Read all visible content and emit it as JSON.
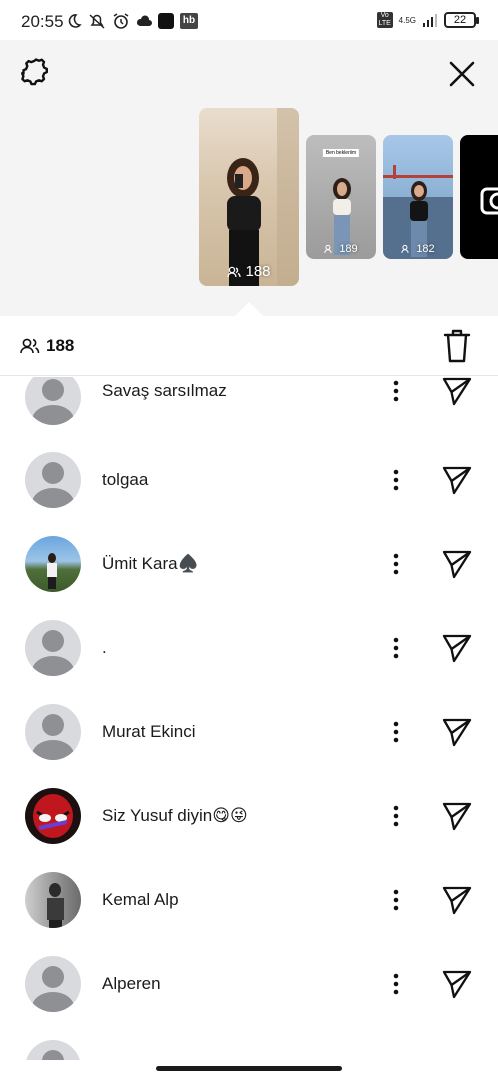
{
  "status_bar": {
    "time": "20:55",
    "network": "4.5G",
    "volte": "Vo LTE",
    "battery": "22",
    "app_badge": "hb"
  },
  "story_panel": {
    "settings_icon": "gear-icon",
    "close_icon": "close-icon",
    "thumbnails": [
      {
        "count": "188",
        "selected": true
      },
      {
        "count": "189",
        "tag": "Ben bekleriim"
      },
      {
        "count": "182"
      },
      {
        "type": "camera"
      }
    ]
  },
  "viewers_header": {
    "count": "188",
    "delete_icon": "trash-icon"
  },
  "viewers": [
    {
      "name": "Savaş sarsılmaz",
      "avatar": "placeholder"
    },
    {
      "name": "tolgaa",
      "avatar": "placeholder"
    },
    {
      "name": "Ümit Kara♠️",
      "avatar": "photo-outdoor"
    },
    {
      "name": ".",
      "avatar": "placeholder"
    },
    {
      "name": "Murat Ekinci",
      "avatar": "placeholder"
    },
    {
      "name": "Siz Yusuf diyin😋😜",
      "avatar": "photo-spiderman"
    },
    {
      "name": "Kemal Alp",
      "avatar": "photo-bw"
    },
    {
      "name": "Alperen",
      "avatar": "placeholder"
    }
  ],
  "colors": {
    "panel_bg": "#f4f4f4",
    "placeholder_bg": "#d9dadd",
    "placeholder_fg": "#8e9094",
    "text": "#1b1b1b"
  }
}
